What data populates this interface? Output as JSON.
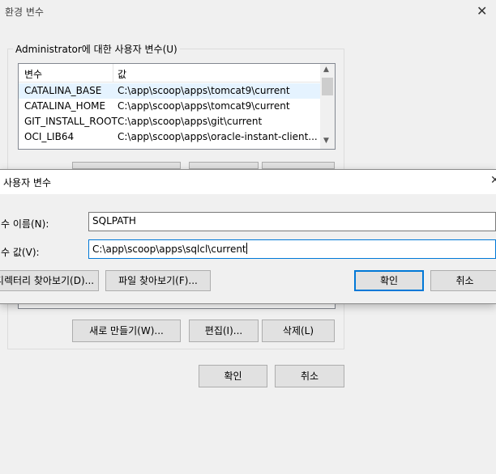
{
  "window": {
    "title": "환경 변수",
    "group_label": "Administrator에 대한 사용자 변수(U)",
    "list": {
      "col_name": "변수",
      "col_value": "값",
      "rows": [
        {
          "name": "CATALINA_BASE",
          "value": "C:\\app\\scoop\\apps\\tomcat9\\current"
        },
        {
          "name": "CATALINA_HOME",
          "value": "C:\\app\\scoop\\apps\\tomcat9\\current"
        },
        {
          "name": "GIT_INSTALL_ROOT",
          "value": "C:\\app\\scoop\\apps\\git\\current"
        },
        {
          "name": "OCI_LIB64",
          "value": "C:\\app\\scoop\\apps\\oracle-instant-client..."
        }
      ]
    },
    "buttons": {
      "new": "새로 만들기(W)...",
      "edit": "편집(I)...",
      "delete": "삭제(L)",
      "ok": "확인",
      "cancel": "취소"
    }
  },
  "dialog": {
    "title": "사용자 변수",
    "name_label": "변수 이름(N):",
    "value_label": "변수 값(V):",
    "name_value": "SQLPATH",
    "value_value": "C:\\app\\scoop\\apps\\sqlcl\\current",
    "browse_dir": "디렉터리 찾아보기(D)...",
    "browse_file": "파일 찾아보기(F)...",
    "ok": "확인",
    "cancel": "취소"
  },
  "icons": {
    "close": "close-icon",
    "scroll_up": "chevron-up-icon",
    "scroll_down": "chevron-down-icon"
  }
}
